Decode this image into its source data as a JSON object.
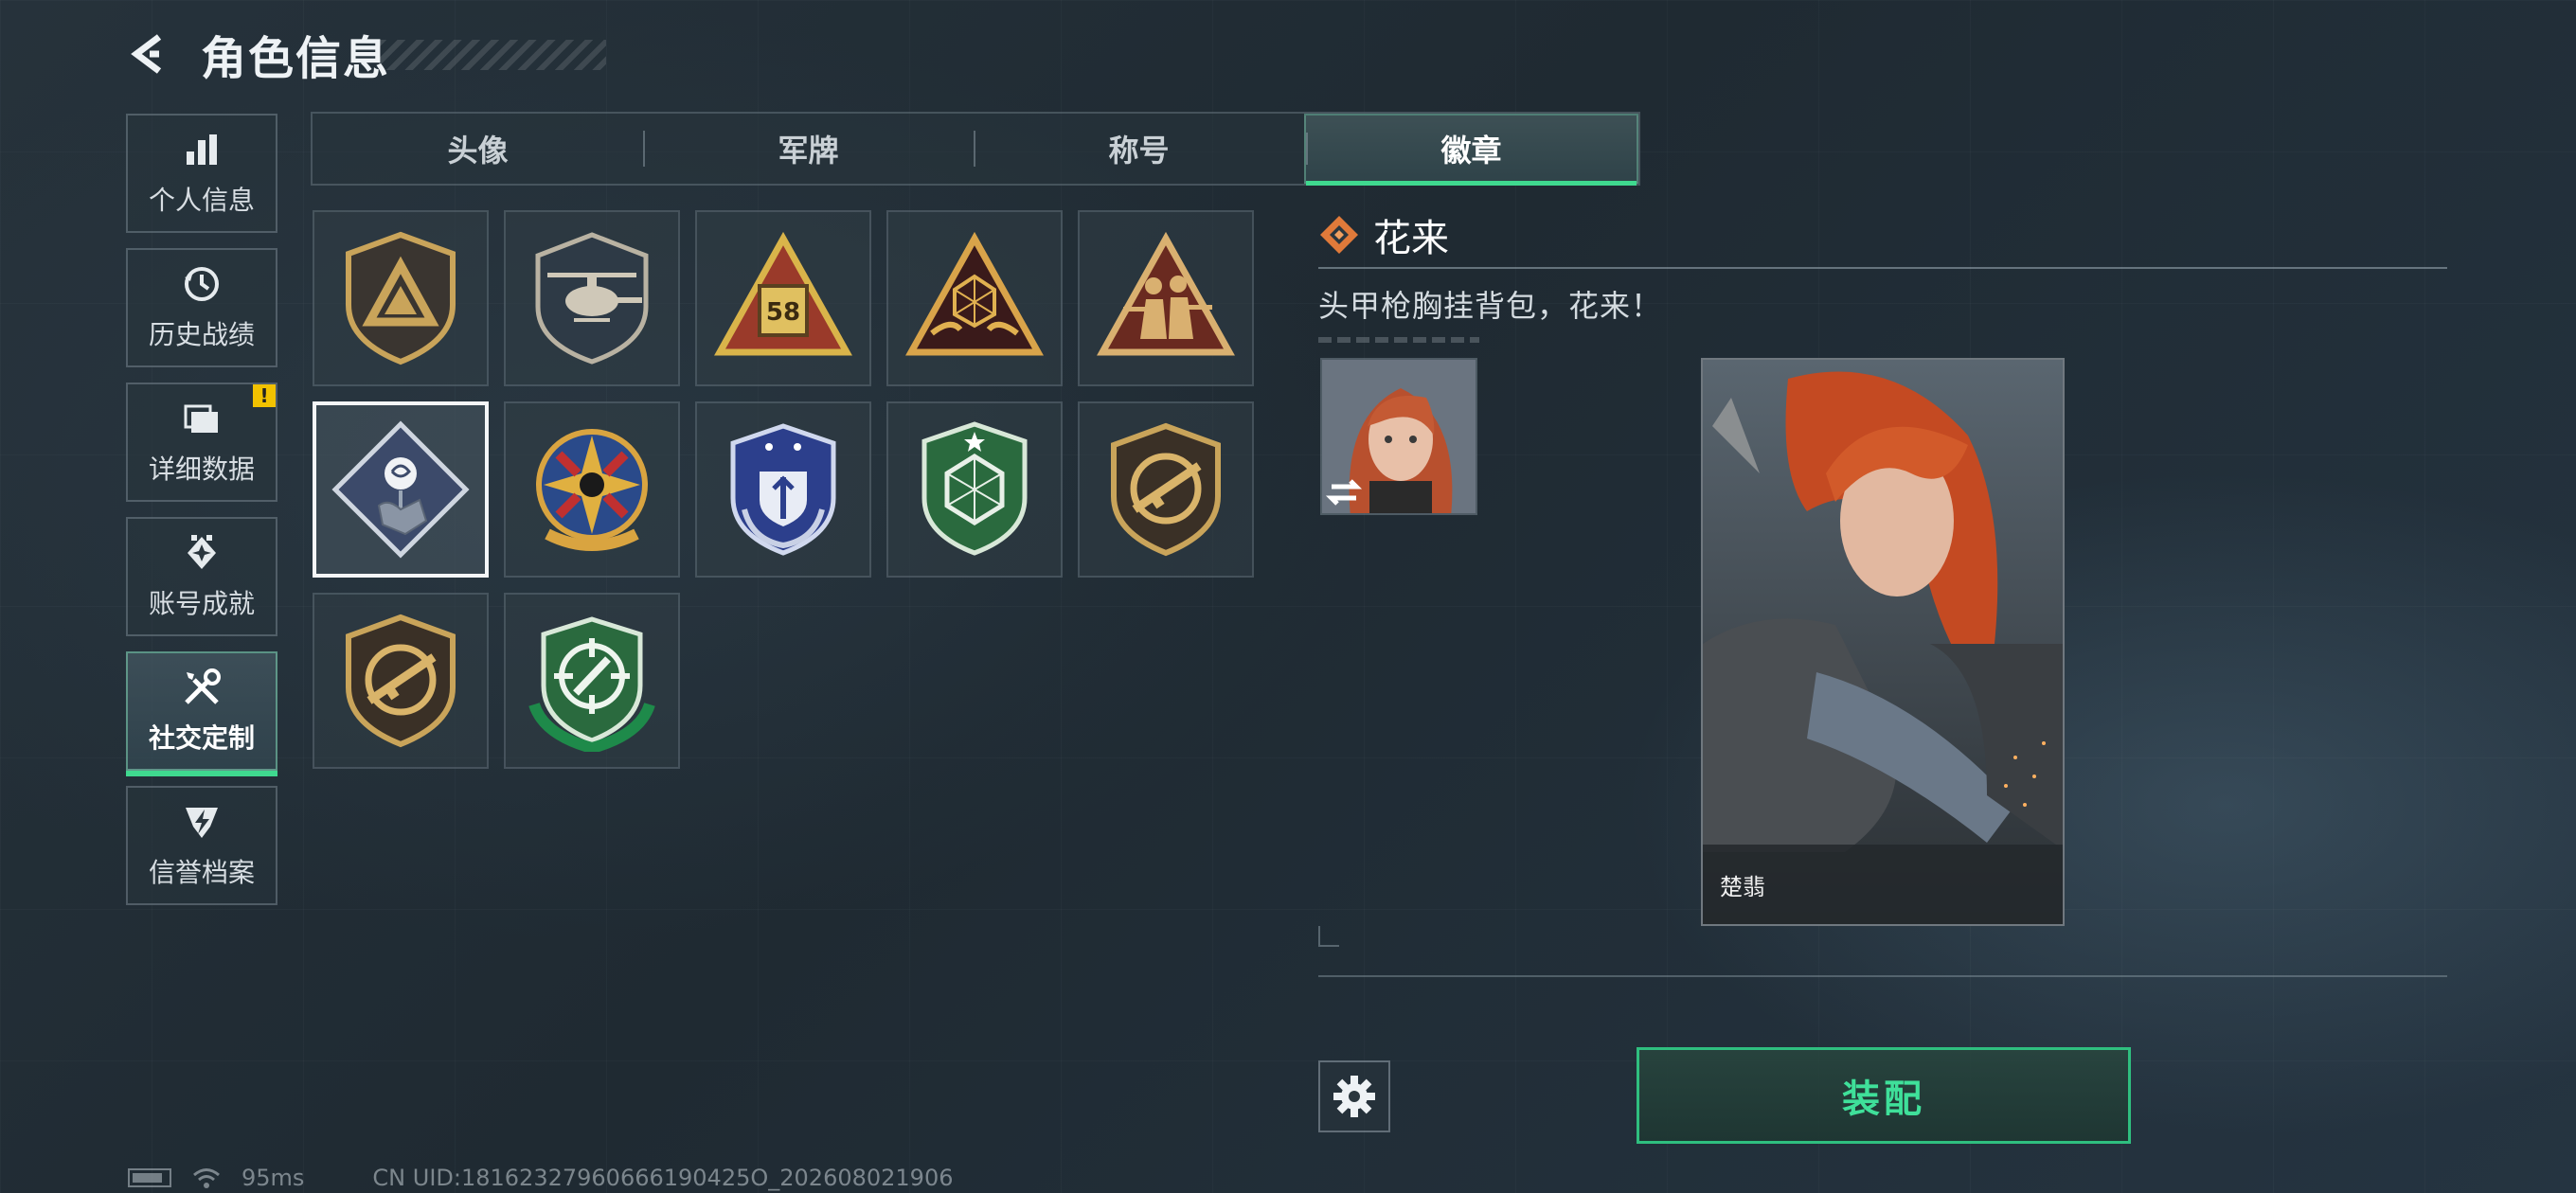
{
  "header": {
    "title": "角色信息"
  },
  "sidebar": {
    "items": [
      {
        "label": "个人信息",
        "icon": "bar-chart-icon"
      },
      {
        "label": "历史战绩",
        "icon": "history-icon"
      },
      {
        "label": "详细数据",
        "icon": "folders-icon",
        "badge": "!"
      },
      {
        "label": "账号成就",
        "icon": "achievement-icon"
      },
      {
        "label": "社交定制",
        "icon": "tools-icon",
        "active": true
      },
      {
        "label": "信誉档案",
        "icon": "shield-lightning-icon"
      }
    ]
  },
  "tabs": [
    {
      "label": "头像"
    },
    {
      "label": "军牌"
    },
    {
      "label": "称号"
    },
    {
      "label": "徽章",
      "active": true
    }
  ],
  "badges": [
    {
      "name": "triangle-shield-badge"
    },
    {
      "name": "helicopter-badge"
    },
    {
      "name": "58-triangle-badge"
    },
    {
      "name": "hands-d20-badge"
    },
    {
      "name": "soldiers-triangle-badge"
    },
    {
      "name": "rose-fist-badge",
      "selected": true
    },
    {
      "name": "star-skull-badge"
    },
    {
      "name": "blue-wreath-badge"
    },
    {
      "name": "green-gem-badge"
    },
    {
      "name": "rifle-shield-badge-1"
    },
    {
      "name": "rifle-shield-badge-2"
    },
    {
      "name": "green-crosshair-badge"
    }
  ],
  "detail": {
    "name": "花来",
    "description": "头甲枪胸挂背包，花来！",
    "character_name": "楚翡"
  },
  "actions": {
    "equip_label": "装配"
  },
  "status": {
    "ping": "95ms",
    "uid": "CN UID:18162327960666190425O_202608021906"
  },
  "colors": {
    "accent": "#3fd98f",
    "gold": "#c9a45a",
    "orange": "#e07a3a"
  }
}
